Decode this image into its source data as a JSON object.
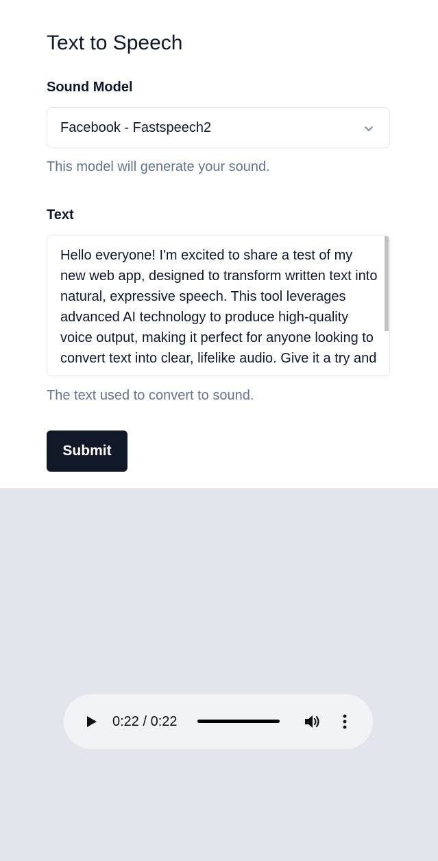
{
  "page": {
    "title": "Text to Speech"
  },
  "model_field": {
    "label": "Sound Model",
    "selected": "Facebook - Fastspeech2",
    "help": "This model will generate your sound."
  },
  "text_field": {
    "label": "Text",
    "value": "Hello everyone! I'm excited to share a test of my new web app, designed to transform written text into natural, expressive speech. This tool leverages advanced AI technology to produce high-quality voice output, making it perfect for anyone looking to convert text into clear, lifelike audio. Give it a try and",
    "help": "The text used to convert to sound."
  },
  "form": {
    "submit_label": "Submit"
  },
  "audio_player": {
    "time": "0:22 / 0:22",
    "progress": 1.0,
    "icons": [
      "play-icon",
      "volume-icon",
      "more-vertical-icon"
    ]
  },
  "colors": {
    "primary_button": "#111827",
    "help_text": "#64748b",
    "audio_background": "#e2e6ec",
    "player_background": "#f1f3f4"
  }
}
